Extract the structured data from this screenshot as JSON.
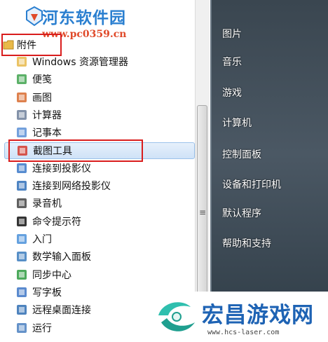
{
  "watermark_top": {
    "title": "河东软件园",
    "url": "www.pc0359.cn"
  },
  "folder": {
    "label": "附件"
  },
  "programs": [
    {
      "label": "Windows 资源管理器",
      "icon": "explorer-icon",
      "color": "#e8b84a"
    },
    {
      "label": "便笺",
      "icon": "sticky-notes-icon",
      "color": "#3fa34d"
    },
    {
      "label": "画图",
      "icon": "paint-icon",
      "color": "#d86b2f"
    },
    {
      "label": "计算器",
      "icon": "calculator-icon",
      "color": "#6d7f9a"
    },
    {
      "label": "记事本",
      "icon": "notepad-icon",
      "color": "#5b8fd6"
    },
    {
      "label": "截图工具",
      "icon": "snipping-tool-icon",
      "color": "#d33a2e"
    },
    {
      "label": "连接到投影仪",
      "icon": "projector-icon",
      "color": "#3a78c8"
    },
    {
      "label": "连接到网络投影仪",
      "icon": "network-projector-icon",
      "color": "#2f6fb9"
    },
    {
      "label": "录音机",
      "icon": "sound-recorder-icon",
      "color": "#444444"
    },
    {
      "label": "命令提示符",
      "icon": "command-prompt-icon",
      "color": "#111111"
    },
    {
      "label": "入门",
      "icon": "getting-started-icon",
      "color": "#4a90d9"
    },
    {
      "label": "数学输入面板",
      "icon": "math-input-icon",
      "color": "#3a7bbd"
    },
    {
      "label": "同步中心",
      "icon": "sync-center-icon",
      "color": "#2e9b3f"
    },
    {
      "label": "写字板",
      "icon": "wordpad-icon",
      "color": "#3d76c6"
    },
    {
      "label": "远程桌面连接",
      "icon": "remote-desktop-icon",
      "color": "#2f6db3"
    },
    {
      "label": "运行",
      "icon": "run-icon",
      "color": "#4a7fbf"
    }
  ],
  "right_panel": [
    "图片",
    "音乐",
    "游戏",
    "计算机",
    "控制面板",
    "设备和打印机",
    "默认程序",
    "帮助和支持"
  ],
  "watermark_bottom": {
    "title": "宏昌游戏网",
    "url": "www.hcs-laser.com"
  }
}
